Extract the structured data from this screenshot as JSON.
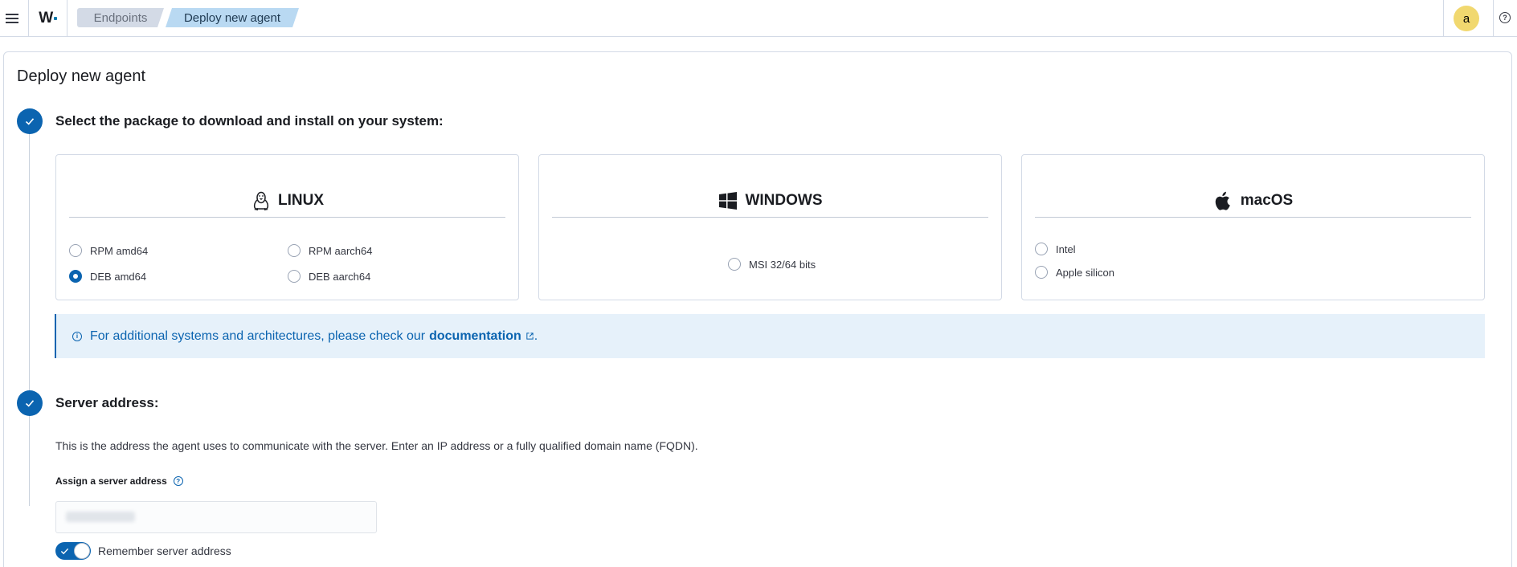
{
  "header": {
    "logo_text": "W",
    "breadcrumbs": [
      "Endpoints",
      "Deploy new agent"
    ],
    "avatar_initial": "a",
    "help_glyph": "?"
  },
  "page": {
    "title": "Deploy new agent"
  },
  "step1": {
    "title": "Select the package to download and install on your system:",
    "linux": {
      "name": "LINUX",
      "icon": "linux-penguin-icon",
      "options": [
        "RPM amd64",
        "RPM aarch64",
        "DEB amd64",
        "DEB aarch64"
      ],
      "selected": "DEB amd64"
    },
    "windows": {
      "name": "WINDOWS",
      "icon": "windows-logo-icon",
      "options": [
        "MSI 32/64 bits"
      ],
      "selected": ""
    },
    "macos": {
      "name": "macOS",
      "icon": "apple-logo-icon",
      "options": [
        "Intel",
        "Apple silicon"
      ],
      "selected": ""
    },
    "callout": {
      "text": "For additional systems and architectures, please check our",
      "link": "documentation",
      "suffix": "."
    }
  },
  "step2": {
    "title": "Server address:",
    "description": "This is the address the agent uses to communicate with the server. Enter an IP address or a fully qualified domain name (FQDN).",
    "field_label": "Assign a server address",
    "server_value": "",
    "remember_label": "Remember server address",
    "remember_checked": true
  },
  "colors": {
    "primary": "#0b64b0",
    "callout_bg": "#e6f1fa",
    "border": "#d3dae6",
    "avatar": "#f1d86f"
  }
}
